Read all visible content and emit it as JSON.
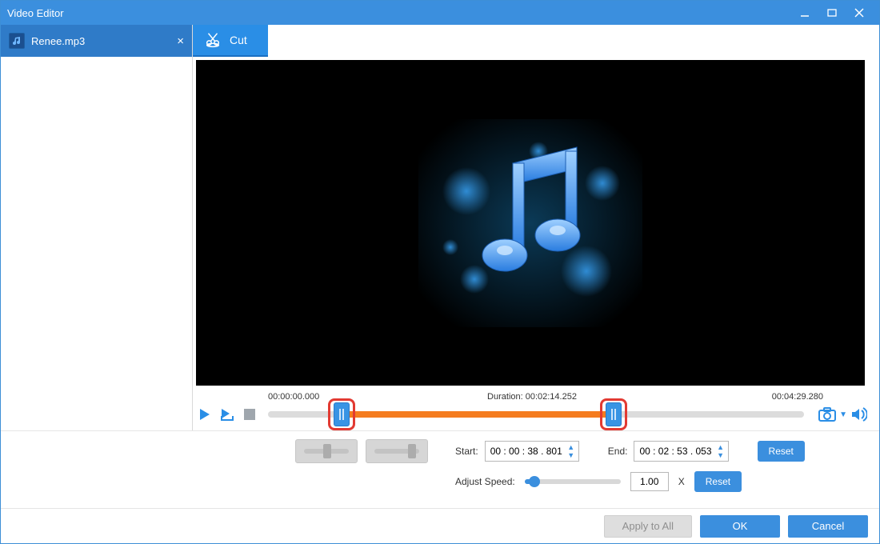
{
  "window": {
    "title": "Video Editor"
  },
  "sidebar": {
    "tab_filename": "Renee.mp3"
  },
  "toolbar": {
    "cut_label": "Cut"
  },
  "timeline": {
    "start_tc": "00:00:00.000",
    "duration_label": "Duration: 00:02:14.252",
    "end_tc": "00:04:29.280",
    "sel_start_pct": 13.8,
    "sel_end_pct": 64.4
  },
  "inputs": {
    "start_label": "Start:",
    "start_value": "00 : 00 : 38 . 801",
    "end_label": "End:",
    "end_value": "00 : 02 : 53 . 053",
    "reset_label": "Reset",
    "speed_label": "Adjust Speed:",
    "speed_value": "1.00",
    "speed_unit": "X",
    "speed_reset": "Reset",
    "speed_fill_pct": 10
  },
  "footer": {
    "apply_all": "Apply to All",
    "ok": "OK",
    "cancel": "Cancel"
  },
  "icons": {
    "music": "music-note-icon",
    "camera": "camera-icon",
    "volume": "volume-icon",
    "play": "play-icon",
    "playmark": "play-marker-icon",
    "stop": "stop-icon",
    "scissor": "scissor-icon"
  }
}
